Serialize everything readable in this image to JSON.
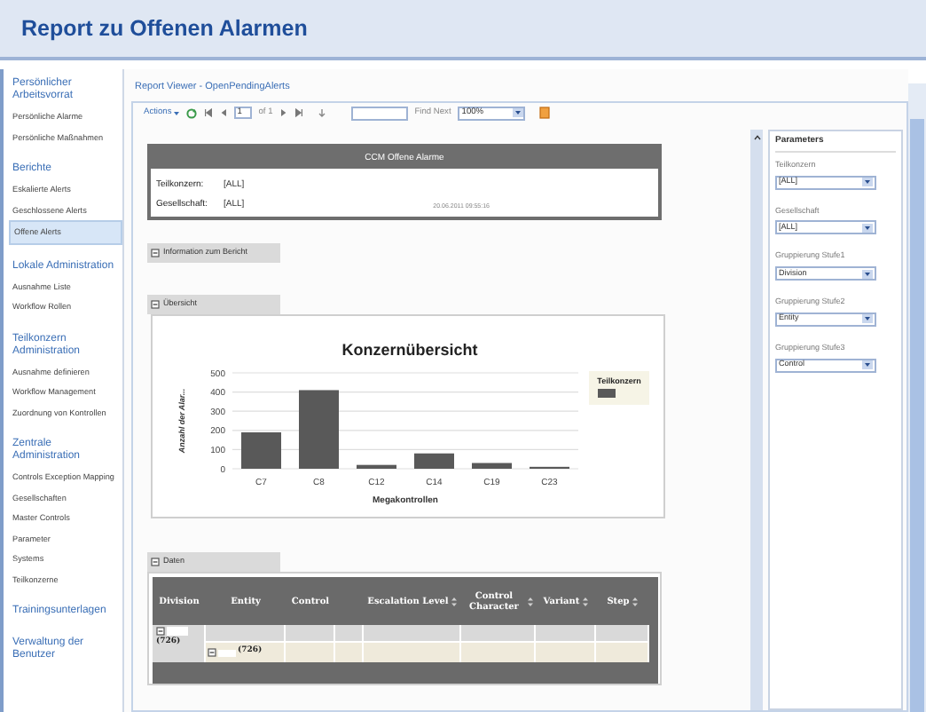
{
  "title": "Report zu Offenen Alarmen",
  "sidebar": {
    "sections": [
      {
        "heading": "Persönlicher Arbeitsvorrat",
        "items": [
          {
            "label": "Persönliche Alarme",
            "selected": false
          },
          {
            "label": "Persönliche Maßnahmen",
            "selected": false
          }
        ]
      },
      {
        "heading": "Berichte",
        "items": [
          {
            "label": "Eskalierte Alerts",
            "selected": false
          },
          {
            "label": "Geschlossene Alerts",
            "selected": false
          },
          {
            "label": "Offene Alerts",
            "selected": true
          }
        ]
      },
      {
        "heading": "Lokale Administration",
        "items": [
          {
            "label": "Ausnahme Liste",
            "selected": false
          },
          {
            "label": "Workflow Rollen",
            "selected": false
          }
        ]
      },
      {
        "heading": "Teilkonzern Administration",
        "items": [
          {
            "label": "Ausnahme definieren",
            "selected": false
          },
          {
            "label": "Workflow Management",
            "selected": false
          },
          {
            "label": "Zuordnung von Kontrollen",
            "selected": false
          }
        ]
      },
      {
        "heading": "Zentrale Administration",
        "items": [
          {
            "label": "Controls Exception Mapping",
            "selected": false
          },
          {
            "label": "Gesellschaften",
            "selected": false
          },
          {
            "label": "Master Controls",
            "selected": false
          },
          {
            "label": "Parameter",
            "selected": false
          },
          {
            "label": "Systems",
            "selected": false
          },
          {
            "label": "Teilkonzerne",
            "selected": false
          }
        ]
      },
      {
        "heading": "Trainingsunterlagen"
      },
      {
        "heading": "Verwaltung der Benutzer"
      }
    ]
  },
  "viewer": {
    "title": "Report Viewer - OpenPendingAlerts",
    "toolbar": {
      "actions": "Actions",
      "page": "1",
      "page_count": "of 1",
      "find_next": "Find Next",
      "zoom": "100%"
    },
    "report": {
      "header": "CCM Offene Alarme",
      "filters": [
        {
          "label": "Teilkonzern:",
          "value": "[ALL]"
        },
        {
          "label": "Gesellschaft:",
          "value": "[ALL]"
        }
      ],
      "timestamp": "20.06.2011 09:55:16",
      "info_section": "Information zum Bericht",
      "overview_section": "Übersicht",
      "chart": {
        "legend_title": "Teilkonzern",
        "chart_data": {
          "type": "bar",
          "title": "Konzernübersicht",
          "xlabel": "Megakontrollen",
          "ylabel": "Anzahl der Alar...",
          "categories": [
            "C7",
            "C8",
            "C12",
            "C14",
            "C19",
            "C23"
          ],
          "series": [
            {
              "color": "#595959",
              "values": [
                190,
                410,
                20,
                80,
                30,
                10
              ]
            }
          ],
          "grid": true,
          "ylim": [
            0,
            500
          ],
          "yticks": [
            0,
            100,
            200,
            300,
            400,
            500
          ]
        }
      },
      "data_section": "Daten",
      "table": {
        "columns": [
          {
            "kind": "column",
            "label": "Division",
            "sortable": false
          },
          {
            "kind": "column",
            "label": "Entity",
            "sortable": false
          },
          {
            "kind": "column",
            "label": "Control",
            "sortable": false
          },
          {
            "kind": "spacer"
          },
          {
            "kind": "column",
            "label": "Escalation Level",
            "sortable": true
          },
          {
            "kind": "column",
            "label": "Control Character",
            "sortable": true
          },
          {
            "kind": "column",
            "label": "Variant",
            "sortable": true
          },
          {
            "kind": "column",
            "label": "Step",
            "sortable": true
          }
        ],
        "group": {
          "division_count": "(726)",
          "entity_count": "(726)"
        }
      }
    },
    "parameters": {
      "heading": "Parameters",
      "fields": [
        {
          "label": "Teilkonzern",
          "value": "[ALL]"
        },
        {
          "label": "Gesellschaft",
          "value": "[ALL]"
        },
        {
          "label": "Gruppierung Stufe1",
          "value": "Division"
        },
        {
          "label": "Gruppierung Stufe2",
          "value": "Entity"
        },
        {
          "label": "Gruppierung Stufe3",
          "value": "Control"
        }
      ]
    }
  }
}
